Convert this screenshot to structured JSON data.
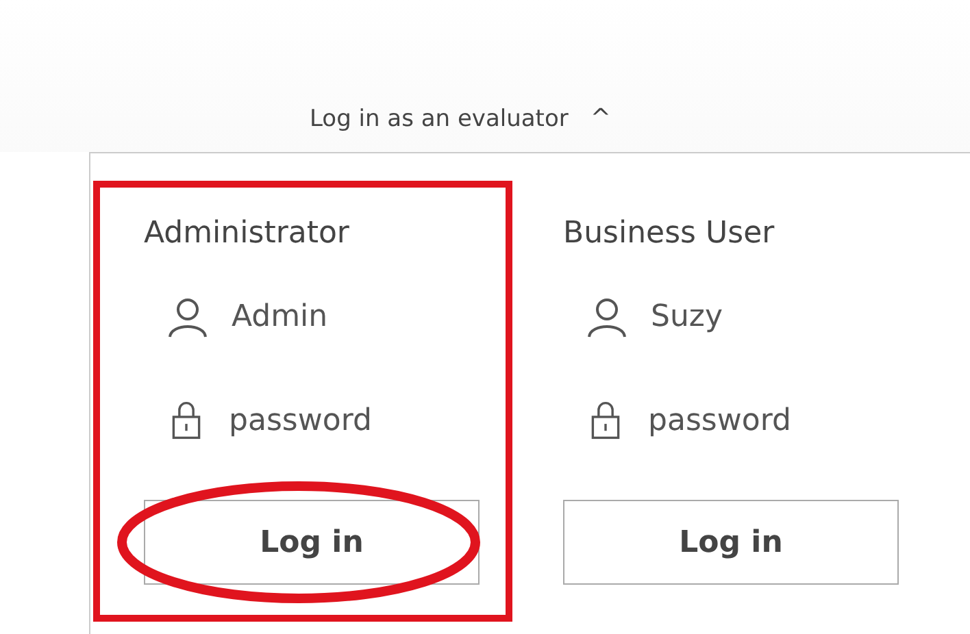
{
  "toggle": {
    "label": "Log in as an evaluator",
    "caret": "^",
    "expanded": true
  },
  "accounts": [
    {
      "role": "Administrator",
      "username": "Admin",
      "password": "password",
      "button": "Log in",
      "highlighted": true,
      "button_circled": true
    },
    {
      "role": "Business User",
      "username": "Suzy",
      "password": "password",
      "button": "Log in",
      "highlighted": false,
      "button_circled": false
    }
  ]
}
